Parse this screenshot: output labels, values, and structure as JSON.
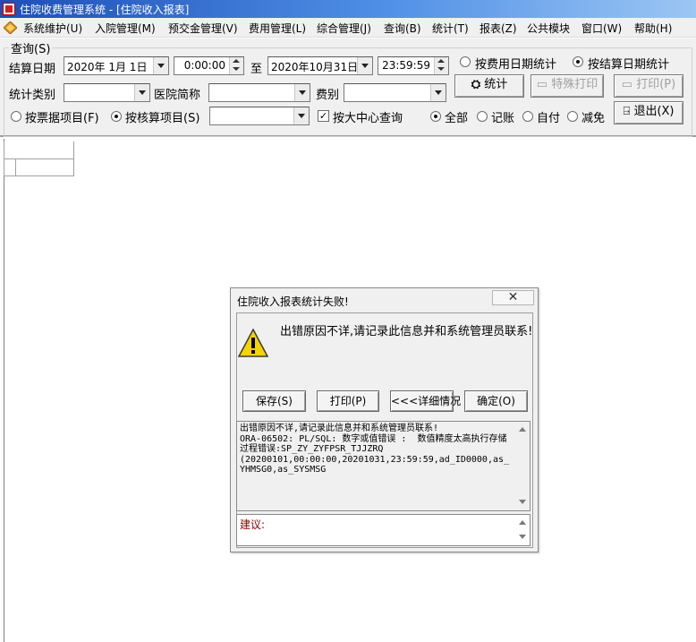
{
  "window": {
    "title": "住院收费管理系统 - [住院收入报表]"
  },
  "menu": {
    "items": [
      "系统维护(U)",
      "入院管理(M)",
      "预交金管理(V)",
      "费用管理(L)",
      "综合管理(J)",
      "查询(B)",
      "统计(T)",
      "报表(Z)",
      "公共模块",
      "窗口(W)",
      "帮助(H)"
    ]
  },
  "query": {
    "group_title": "查询(S)",
    "settle_date_label": "结算日期",
    "start_date": "2020年 1月 1日",
    "start_time": "0:00:00",
    "to_label": "至",
    "end_date": "2020年10月31日",
    "end_time": "23:59:59",
    "radio_fee_date": "按费用日期统计",
    "radio_settle_date": "按结算日期统计",
    "stat_type_label": "统计类别",
    "stat_type_value": "",
    "hospital_label": "医院简称",
    "hospital_value": "",
    "fee_label": "费别",
    "fee_value": "",
    "radio_bill_item": "按票据项目(F)",
    "radio_audit_item": "按核算项目(S)",
    "audit_item_value": "",
    "check_center": "按大中心查询",
    "check_center_mark": "✓",
    "radio_all": "全部",
    "radio_account": "记账",
    "radio_self": "自付",
    "radio_reduce": "减免"
  },
  "buttons": {
    "stat": "统计",
    "special_print": "特殊打印",
    "print": "打印(P)",
    "exit": "退出(X)"
  },
  "dialog": {
    "title": "住院收入报表统计失败!",
    "close": "✕",
    "message": "出错原因不详,请记录此信息并和系统管理员联系!",
    "save": "保存(S)",
    "print": "打印(P)",
    "details": "<<<详细情况",
    "ok": "确定(O)",
    "detail_text": "出错原因不详,请记录此信息并和系统管理员联系!\nORA-06502: PL/SQL: 数字或值错误 :  数值精度太高执行存储过程错误:SP_ZY_ZYFPSR_TJJZRQ\n(20200101,00:00:00,20201031,23:59:59,ad_ID0000,as_YHMSG0,as_SYSMSG",
    "suggest_label": "建议:"
  },
  "colors": {
    "titlebar": "#1d4fb8",
    "background": "#f0f0f0",
    "warning": "#f5d400"
  }
}
